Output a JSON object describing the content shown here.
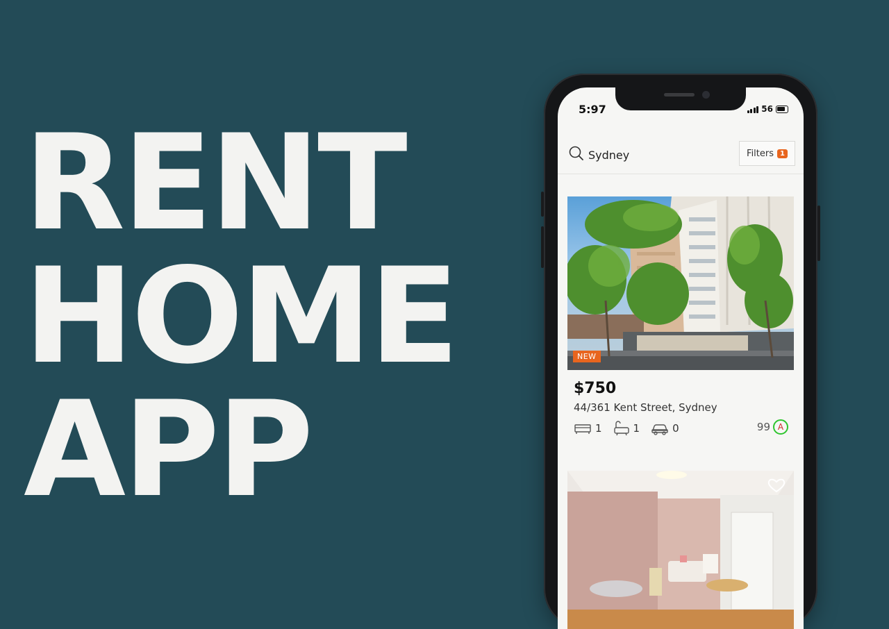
{
  "hero": {
    "line1": "RENT",
    "line2": "HOME",
    "line3": "APP"
  },
  "status": {
    "time": "5:97",
    "network": "56"
  },
  "search": {
    "location": "Sydney",
    "filters_label": "Filters",
    "filters_count": "1"
  },
  "listings": [
    {
      "badge": "NEW",
      "price": "$750",
      "address": "44/361 Kent Street, Sydney",
      "bedrooms": "1",
      "bathrooms": "1",
      "parking": "0",
      "score": "99",
      "score_letter": "A"
    }
  ],
  "colors": {
    "background": "#234b57",
    "accent": "#e8651e",
    "score_ring": "#2ec52e"
  }
}
